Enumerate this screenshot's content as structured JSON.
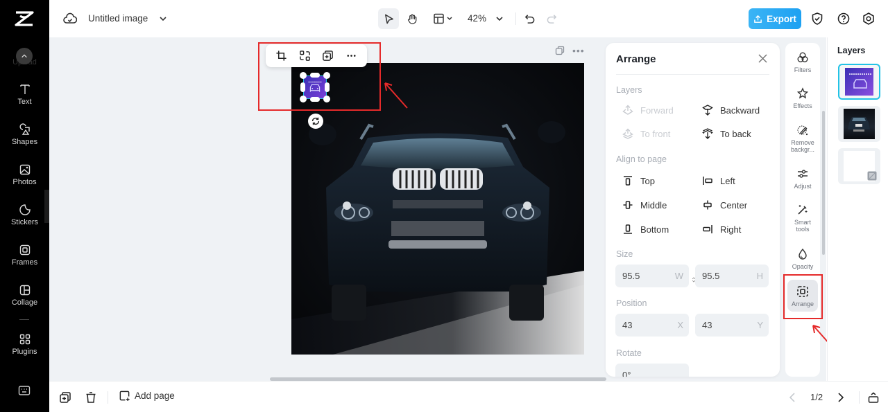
{
  "app": {
    "doc_title": "Untitled image",
    "zoom_level": "42%",
    "export_label": "Export",
    "brand_color": "#1ea1f2",
    "selection_color": "#22c3e6",
    "annotation_color": "#e52a2a"
  },
  "sidebar": {
    "upload_label": "Upload",
    "items": [
      {
        "label": "Text",
        "icon": "text-icon"
      },
      {
        "label": "Shapes",
        "icon": "shapes-icon"
      },
      {
        "label": "Photos",
        "icon": "photos-icon"
      },
      {
        "label": "Stickers",
        "icon": "stickers-icon"
      },
      {
        "label": "Frames",
        "icon": "frames-icon"
      },
      {
        "label": "Collage",
        "icon": "collage-icon"
      },
      {
        "label": "Plugins",
        "icon": "plugins-icon"
      }
    ]
  },
  "toolbar": {
    "tools": [
      "select-tool",
      "hand-tool",
      "layout-tool"
    ],
    "undo": "undo",
    "redo": "redo"
  },
  "float_toolbar": [
    "crop",
    "replace",
    "duplicate",
    "more"
  ],
  "arrange": {
    "title": "Arrange",
    "layers_label": "Layers",
    "layer_actions": [
      {
        "label": "Forward",
        "enabled": false
      },
      {
        "label": "Backward",
        "enabled": true
      },
      {
        "label": "To front",
        "enabled": false
      },
      {
        "label": "To back",
        "enabled": true
      }
    ],
    "align_label": "Align to page",
    "align_actions": [
      "Top",
      "Left",
      "Middle",
      "Center",
      "Bottom",
      "Right"
    ],
    "size_label": "Size",
    "width": "95.5",
    "width_unit": "W",
    "height": "95.5",
    "height_unit": "H",
    "position_label": "Position",
    "x": "43",
    "x_unit": "X",
    "y": "43",
    "y_unit": "Y",
    "rotate_label": "Rotate",
    "rotate": "0°"
  },
  "tools": [
    {
      "label": "Filters"
    },
    {
      "label": "Effects"
    },
    {
      "label": "Remove backgr..."
    },
    {
      "label": "Adjust"
    },
    {
      "label": "Smart tools"
    },
    {
      "label": "Opacity"
    },
    {
      "label": "Arrange",
      "active": true
    }
  ],
  "layers_panel": {
    "title": "Layers",
    "layers": [
      "logo",
      "car-photo",
      "background"
    ]
  },
  "bottom": {
    "add_page_label": "Add page",
    "page_indicator": "1/2"
  }
}
